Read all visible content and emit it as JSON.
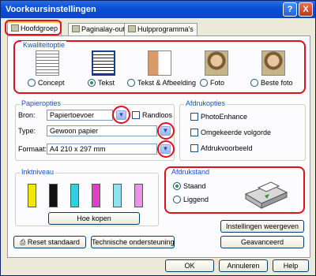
{
  "window": {
    "title": "Voorkeursinstellingen",
    "help_label": "?",
    "close_label": "X"
  },
  "tabs": [
    {
      "label": "Hoofdgroep",
      "active": true
    },
    {
      "label": "Paginalay-out",
      "active": false
    },
    {
      "label": "Hulpprogramma's",
      "active": false
    }
  ],
  "kwaliteit": {
    "title": "Kwaliteitoptie",
    "options": [
      {
        "label": "Concept",
        "selected": false
      },
      {
        "label": "Tekst",
        "selected": true
      },
      {
        "label": "Tekst & Afbeelding",
        "selected": false
      },
      {
        "label": "Foto",
        "selected": false
      },
      {
        "label": "Beste foto",
        "selected": false
      }
    ]
  },
  "papier": {
    "title": "Papieropties",
    "bron_label": "Bron:",
    "bron_value": "Papiertoevoer",
    "randloos_label": "Randloos",
    "type_label": "Type:",
    "type_value": "Gewoon papier",
    "formaat_label": "Formaat:",
    "formaat_value": "A4 210 x 297 mm"
  },
  "afdrukopties": {
    "title": "Afdrukopties",
    "items": [
      "PhotoEnhance",
      "Omgekeerde volgorde",
      "Afdrukvoorbeeld"
    ]
  },
  "inkt": {
    "title": "Inktniveau",
    "colors": [
      "#f3e600",
      "#111111",
      "#2fd0e0",
      "#e040c8",
      "#8fe3ef",
      "#f08fe6"
    ],
    "button_label": "Hoe kopen"
  },
  "afdrukstand": {
    "title": "Afdrukstand",
    "staand": "Staand",
    "liggend": "Liggend",
    "selected": "staand"
  },
  "buttons": {
    "instellingen": "Instellingen weergeven",
    "reset": "Reset standaard",
    "technische": "Technische ondersteuning",
    "geavanceerd": "Geavanceerd",
    "ok": "OK",
    "annuleren": "Annuleren",
    "help": "Help"
  },
  "colors": {
    "highlight": "#e0101e",
    "group_label": "#1f4ec8",
    "title_bar": "#0a50d8"
  }
}
